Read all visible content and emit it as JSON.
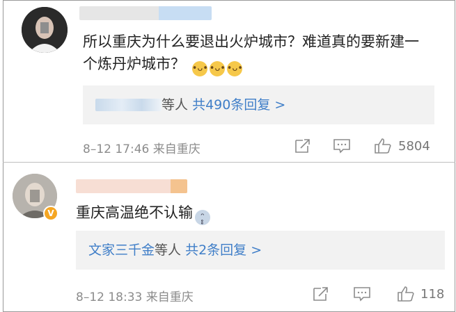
{
  "comments": [
    {
      "text": "所以重庆为什么要退出火炉城市？难道真的要新建一个炼丹炉城市？",
      "emojis": [
        "doge",
        "doge",
        "doge"
      ],
      "reply_suffix": "等人",
      "reply_link": "共490条回复 >",
      "time": "8–12 17:46",
      "source": "来自重庆",
      "likes": "5804"
    },
    {
      "text": "重庆高温绝不认输",
      "emojis": [
        "cry"
      ],
      "reply_names": "文家三千金",
      "reply_suffix": "等人",
      "reply_link": "共2条回复 >",
      "time": "8–12 18:33",
      "source": "来自重庆",
      "likes": "118",
      "verified_badge": "V"
    }
  ],
  "icons": [
    "share-icon",
    "comment-icon",
    "like-icon",
    "doge-emoji-icon",
    "cry-emoji-icon",
    "verified-badge-icon"
  ]
}
